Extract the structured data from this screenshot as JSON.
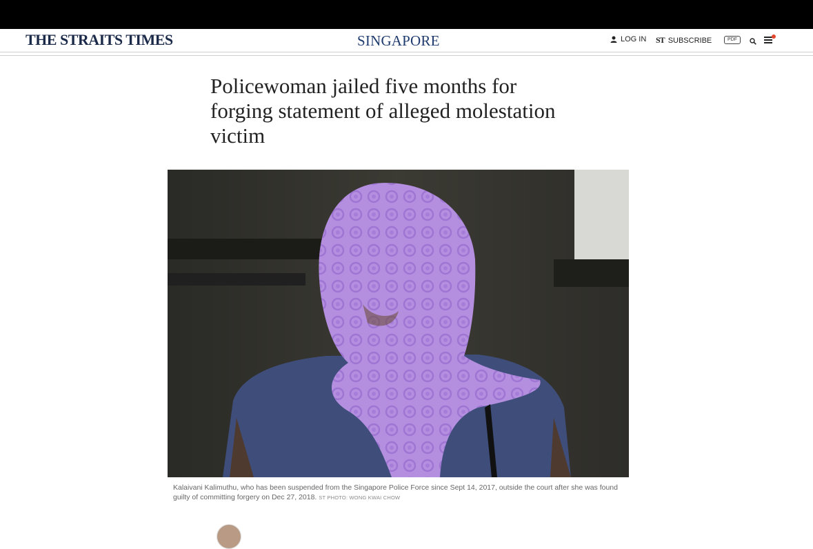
{
  "header": {
    "logo": "THE STRAITS TIMES",
    "section": "SINGAPORE",
    "login_label": "LOG IN",
    "subscribe_mark": "ST",
    "subscribe_label": "SUBSCRIBE",
    "pdf_label": "PDF"
  },
  "article": {
    "headline": "Policewoman jailed five months for forging statement of alleged molestation victim",
    "caption": "Kalaivani Kalimuthu, who has been suspended from the Singapore Police Force since Sept 14, 2017, outside the court after she was found guilty of committing forgery on Dec 27, 2018.",
    "photo_credit": "ST PHOTO: WONG KWAI CHOW"
  },
  "colors": {
    "logo": "#1c2a49",
    "section": "#1f3b6e",
    "notification_dot": "#e2472f",
    "scarf": "#b48fe0"
  },
  "icons": [
    "user-icon",
    "search-icon",
    "menu-icon"
  ]
}
